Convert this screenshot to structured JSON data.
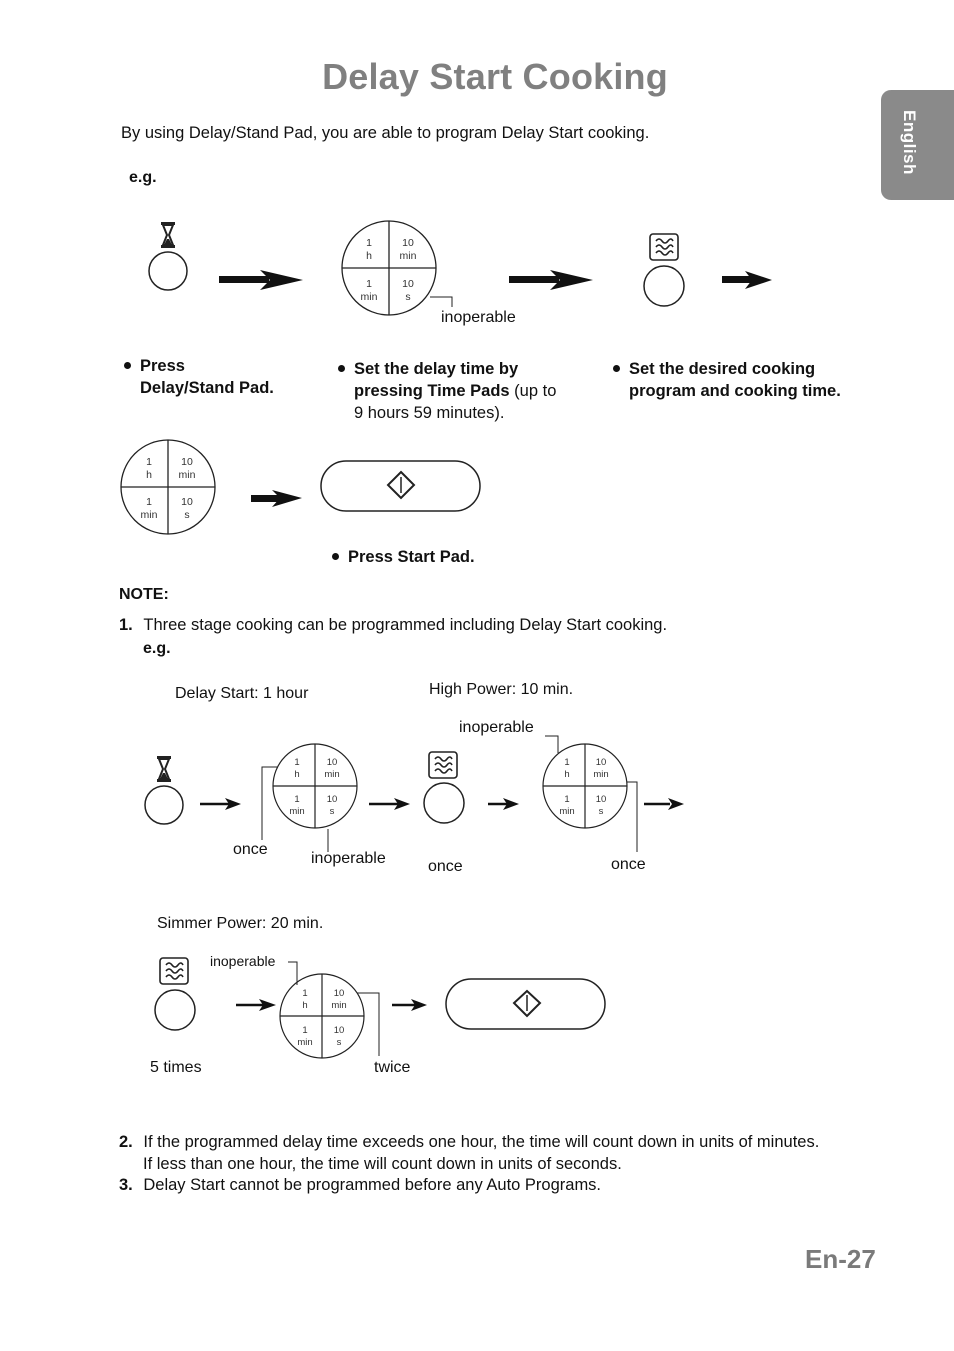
{
  "page": {
    "title": "Delay Start Cooking",
    "intro": "By using Delay/Stand Pad, you are able to program Delay Start cooking.",
    "language_tab": "English",
    "page_number": "En-27"
  },
  "example1": {
    "eg_label": "e.g.",
    "time_pad": {
      "top_left": [
        "1",
        "h"
      ],
      "top_right": [
        "10",
        "min"
      ],
      "bottom_left": [
        "1",
        "min"
      ],
      "bottom_right": [
        "10",
        "s"
      ]
    },
    "inoperable_label": "inoperable",
    "steps": [
      {
        "bold": "Press Delay/Stand Pad.",
        "line1": "Press",
        "line2": "Delay/Stand Pad.",
        "normal": ""
      },
      {
        "line1": "Set the delay time by",
        "line2_bold": "pressing Time Pads",
        "line2_normal": " (up to",
        "line3": "9 hours 59 minutes)."
      },
      {
        "line1": "Set the desired cooking",
        "line2": "program and cooking time."
      }
    ],
    "start_step": "Press Start Pad."
  },
  "notes": {
    "heading": "NOTE:",
    "items": [
      {
        "number": "1.",
        "text": "Three stage cooking can be programmed including Delay Start cooking."
      },
      {
        "number": "2.",
        "text": "If the programmed delay time exceeds one hour, the time will count down in units of minutes.",
        "text2": "If less than one hour, the time will count down in units of seconds."
      },
      {
        "number": "3.",
        "text": "Delay Start cannot be programmed before any Auto Programs."
      }
    ],
    "eg_label": "e.g."
  },
  "example2": {
    "stage1_label": "Delay Start: 1 hour",
    "stage2_label": "High Power: 10 min.",
    "stage3_label": "Simmer Power: 20 min.",
    "once_1": "once",
    "inoperable_1": "inoperable",
    "once_2": "once",
    "inoperable_2": "inoperable",
    "once_3": "once",
    "inoperable_3": "inoperable",
    "five_times": "5 times",
    "twice": "twice"
  },
  "icons": {
    "delay_stand": "hourglass-icon",
    "power_level": "microwave-wave-icon",
    "start": "start-diamond-icon"
  }
}
